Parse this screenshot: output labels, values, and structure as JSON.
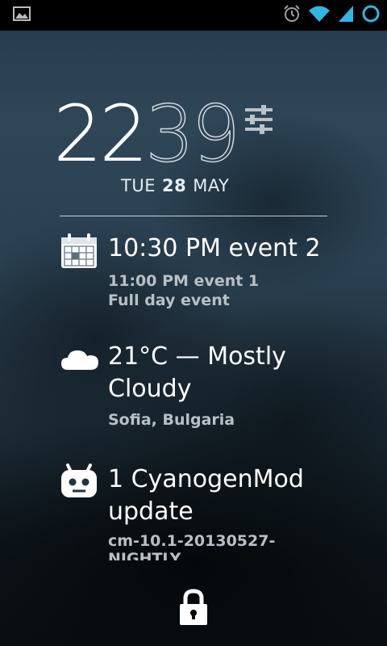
{
  "clock": {
    "hours": "22",
    "minutes": "39"
  },
  "date": {
    "weekday": "TUE",
    "day": "28",
    "month": "MAY"
  },
  "calendar": {
    "primary": "10:30 PM event 2",
    "secondary": "11:00 PM event 1",
    "tertiary": "Full day event"
  },
  "weather": {
    "summary": "21°C — Mostly Cloudy",
    "location": "Sofia, Bulgaria"
  },
  "updates": {
    "title": "1 CyanogenMod update",
    "detail": "cm-10.1-20130527-",
    "detail_cut": "NIGHTLY"
  },
  "icons": {
    "status_left": "image-icon",
    "alarm": "alarm-icon",
    "wifi": "wifi-icon",
    "signal": "signal-icon",
    "battery": "battery-ring-icon",
    "settings": "sliders-icon",
    "calendar": "calendar-icon",
    "weather": "cloud-icon",
    "cm": "cyanogenmod-mascot-icon",
    "lock": "padlock-icon"
  },
  "colors": {
    "wifi_accent": "#33b5e5",
    "battery_accent": "#33b5e5"
  }
}
